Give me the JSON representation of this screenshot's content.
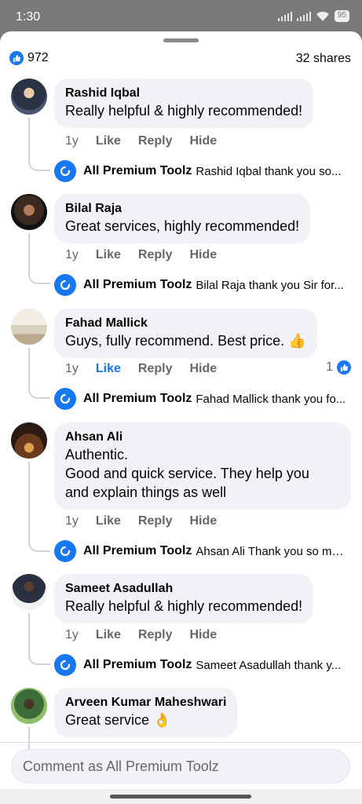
{
  "status_bar": {
    "time": "1:30",
    "battery": "95"
  },
  "summary": {
    "likes": "972",
    "shares": "32 shares"
  },
  "actions": {
    "like": "Like",
    "reply": "Reply",
    "hide": "Hide"
  },
  "comments": [
    {
      "name": "Rashid Iqbal",
      "text": "Really helpful & highly recommended!",
      "time": "1y",
      "reply": {
        "author": "All Premium Toolz",
        "text": "Rashid Iqbal thank you so..."
      }
    },
    {
      "name": "Bilal Raja",
      "text": "Great services, highly recommended!",
      "time": "1y",
      "reply": {
        "author": "All Premium Toolz",
        "text": "Bilal Raja  thank you Sir for..."
      }
    },
    {
      "name": "Fahad Mallick",
      "text": "Guys, fully recommend. Best price. 👍",
      "time": "1y",
      "reaction_count": "1",
      "reply": {
        "author": "All Premium Toolz",
        "text": "Fahad Mallick thank you fo..."
      }
    },
    {
      "name": "Ahsan Ali",
      "text": "Authentic.\nGood and quick service. They help you\nand explain things as well",
      "time": "1y",
      "reply": {
        "author": "All Premium Toolz",
        "text": "Ahsan Ali Thank you so mu..."
      }
    },
    {
      "name": "Sameet Asadullah",
      "text": "Really helpful & highly recommended!",
      "time": "1y",
      "reply": {
        "author": "All Premium Toolz",
        "text": "Sameet Asadullah  thank y..."
      }
    },
    {
      "name": "Arveen Kumar Maheshwari",
      "text": "Great service 👌"
    }
  ],
  "composer": {
    "placeholder": "Comment as All Premium Toolz"
  },
  "colors": {
    "accent": "#1877f2",
    "bubble": "#f0f2f5",
    "muted": "#65676b"
  }
}
